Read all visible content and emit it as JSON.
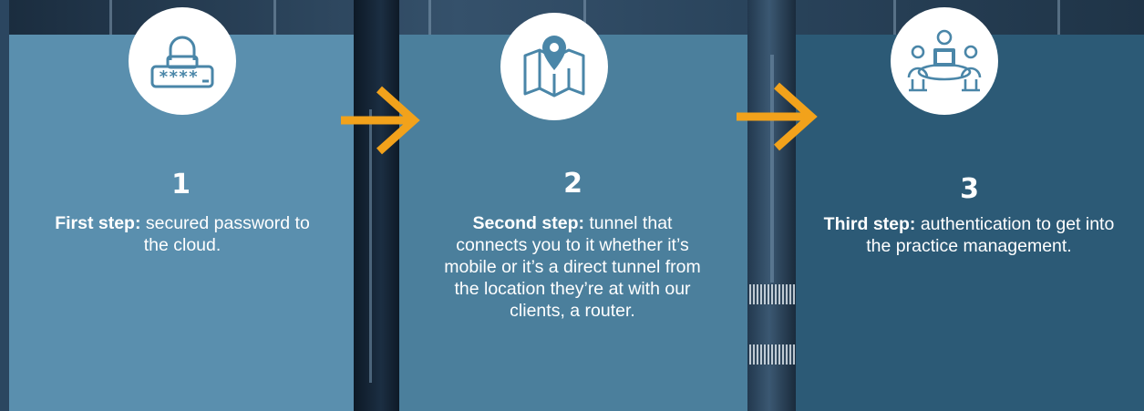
{
  "steps": [
    {
      "number": "1",
      "lead": "First step:",
      "text": " secured password to the cloud."
    },
    {
      "number": "2",
      "lead": "Second step:",
      "text": " tunnel that connects you to it whether it’s mobile or it’s a direct tunnel from the location they’re at with our clients, a router."
    },
    {
      "number": "3",
      "lead": "Third step:",
      "text": " authentication to get into the practice management."
    }
  ],
  "icons": [
    "password-lock-icon",
    "map-pin-icon",
    "meeting-people-icon"
  ],
  "colors": {
    "panel1": "#5a8fae",
    "panel2": "#4b7f9c",
    "panel3": "#2c5a76",
    "arrow": "#f2a21b",
    "icon": "#4a86a8"
  }
}
